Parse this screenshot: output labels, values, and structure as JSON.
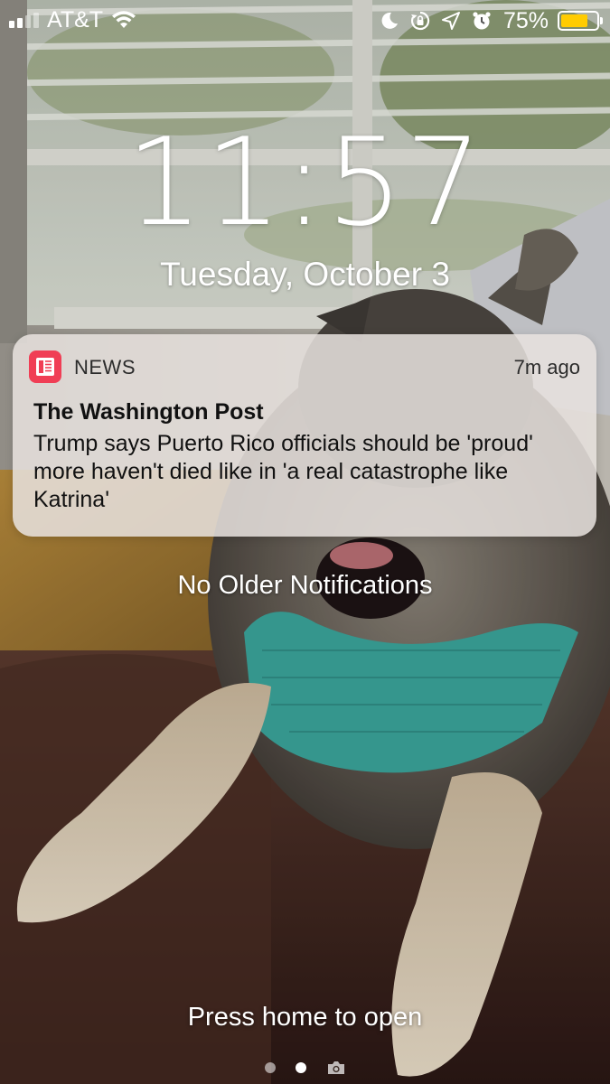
{
  "status_bar": {
    "carrier": "AT&T",
    "battery_percent": "75%",
    "battery_level": 0.75,
    "signal_bars_filled": 2,
    "signal_bars_total": 5,
    "icons": [
      "wifi-icon",
      "do-not-disturb-icon",
      "rotation-lock-icon",
      "location-icon",
      "alarm-icon",
      "battery-icon"
    ]
  },
  "lock_screen": {
    "time": "11:57",
    "date": "Tuesday, October 3"
  },
  "notification": {
    "app_name": "NEWS",
    "app_icon": "news-app-icon",
    "app_icon_color": "#f03e55",
    "time_ago": "7m ago",
    "title": "The Washington Post",
    "body": "Trump says Puerto Rico officials should be 'proud' more haven't died like in 'a real catastrophe like Katrina'"
  },
  "no_older_notifications": "No Older Notifications",
  "press_home": "Press home to open",
  "page_indicator": {
    "pages": 2,
    "active_index": 1,
    "trailing_icon": "camera-icon"
  },
  "colors": {
    "battery": "#ffcc00",
    "notification_bg": "#e8e2de"
  }
}
